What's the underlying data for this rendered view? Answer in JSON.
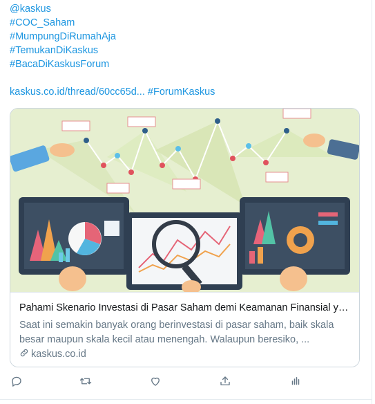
{
  "tweet": {
    "lines": [
      "@kaskus",
      "#COC_Saham",
      "#MumpungDiRumahAja",
      "#TemukanDiKaskus",
      "#BacaDiKaskusForum"
    ],
    "link_text": "kaskus.co.id/thread/60cc65d...",
    "hashtag_tail": "#ForumKaskus"
  },
  "card": {
    "title": "Pahami Skenario Investasi di Pasar Saham demi Keamanan Finansial ya...",
    "description": "Saat ini semakin banyak orang berinvestasi di pasar saham, baik skala besar maupun skala kecil atau menengah. Walaupun beresiko, ...",
    "domain": "kaskus.co.id",
    "image_icon": "stock-market-illustration"
  },
  "actions": {
    "icons": [
      "reply-icon",
      "retweet-icon",
      "like-icon",
      "share-icon",
      "analytics-icon"
    ]
  },
  "colors": {
    "link": "#1b95e0",
    "muted": "#657786",
    "text": "#14171a",
    "border": "#ccd6dd"
  }
}
